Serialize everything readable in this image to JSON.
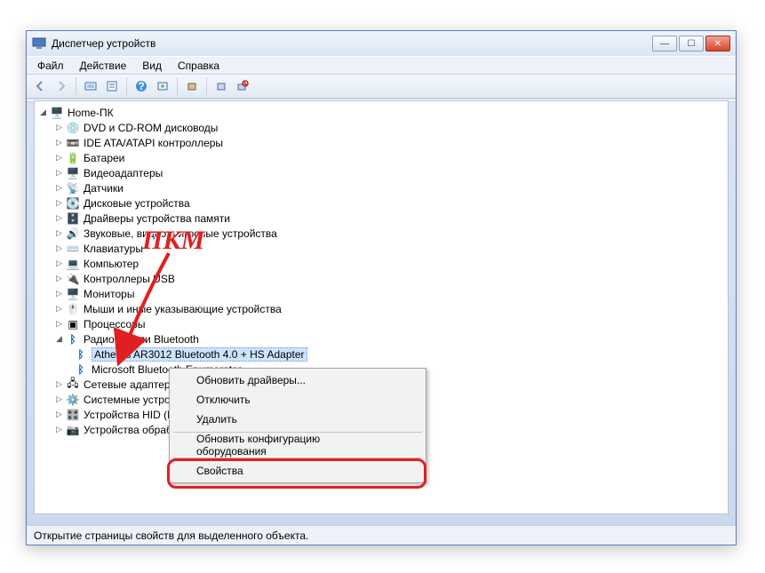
{
  "window": {
    "title": "Диспетчер устройств"
  },
  "menu": {
    "file": "Файл",
    "action": "Действие",
    "view": "Вид",
    "help": "Справка"
  },
  "tree": {
    "root": "Home-ПК",
    "items": [
      "DVD и CD-ROM дисководы",
      "IDE ATA/ATAPI контроллеры",
      "Батареи",
      "Видеоадаптеры",
      "Датчики",
      "Дисковые устройства",
      "Драйверы устройства памяти",
      "Звуковые, видео и игровые устройства",
      "Клавиатуры",
      "Компьютер",
      "Контроллеры USB",
      "Мониторы",
      "Мыши и иные указывающие устройства",
      "Процессоры"
    ],
    "bt_group": "Радиомодули Bluetooth",
    "bt_selected": "Atheros AR3012 Bluetooth 4.0 + HS Adapter",
    "bt_other": "Microsoft Bluetooth Enumerator",
    "tail": [
      "Сетевые адаптеры",
      "Системные устройства",
      "Устройства HID (Human Interface Devices)",
      "Устройства обработки изображений"
    ]
  },
  "context_menu": {
    "update": "Обновить драйверы...",
    "disable": "Отключить",
    "delete": "Удалить",
    "rescan": "Обновить конфигурацию оборудования",
    "properties": "Свойства"
  },
  "status": "Открытие страницы свойств для выделенного объекта.",
  "annotation": "ПКМ",
  "icons": {
    "computer": "🖥️",
    "disc": "💿",
    "ide": "📼",
    "battery": "🔋",
    "video": "🖥️",
    "sensor": "📡",
    "disk": "💽",
    "memory": "🗄️",
    "sound": "🔊",
    "keyboard": "⌨️",
    "pc": "💻",
    "usb": "🔌",
    "monitor": "🖥️",
    "mouse": "🖱️",
    "cpu": "▣",
    "bluetooth": "ᛒ",
    "net": "🖧",
    "sys": "⚙️",
    "hid": "🎛️",
    "image": "📷"
  }
}
